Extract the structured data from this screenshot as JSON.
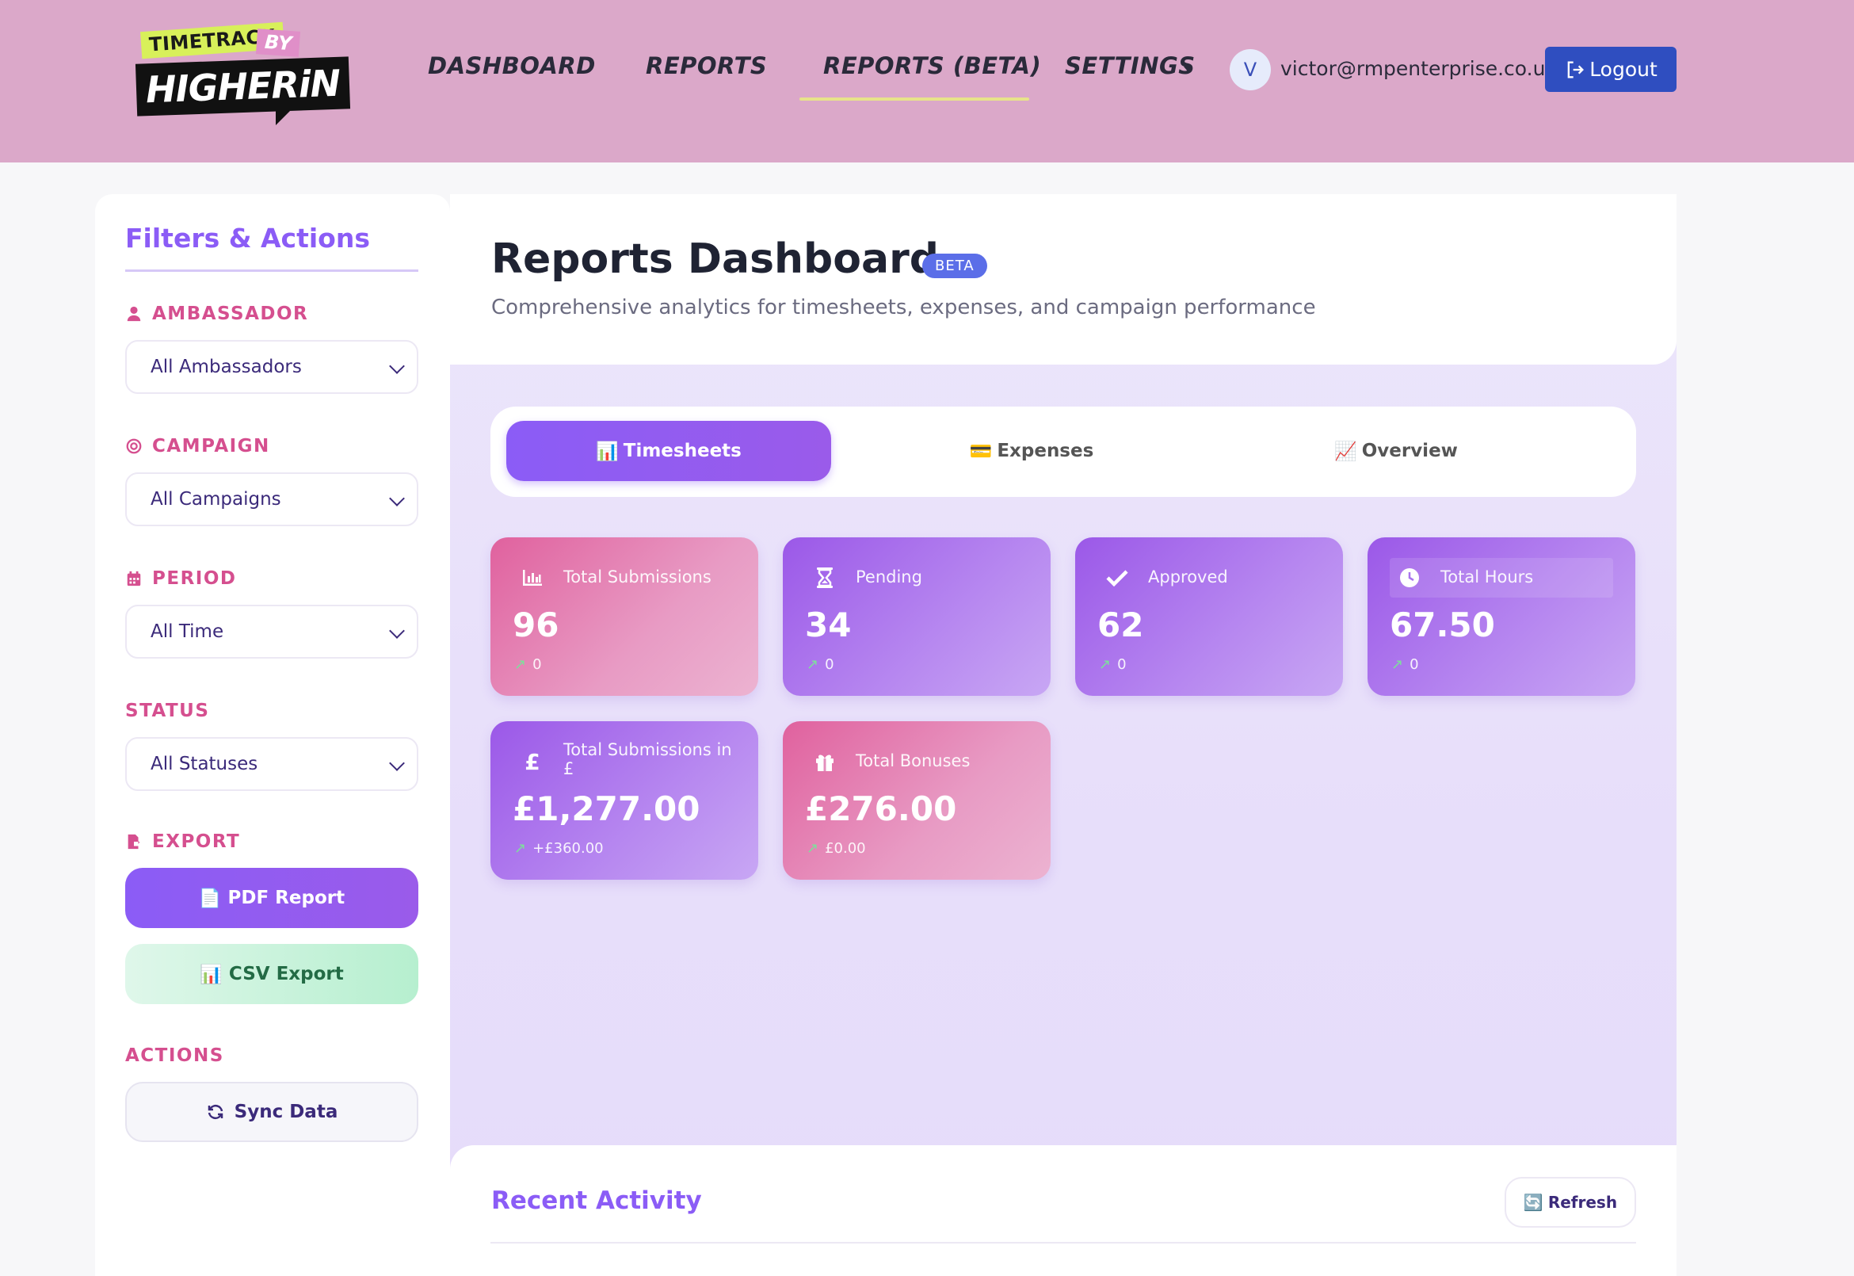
{
  "brand": {
    "logo_line1": "TIMETRACK",
    "logo_by": "BY",
    "logo_line2": "HIGHERiN"
  },
  "nav": {
    "items": [
      {
        "label": "DASHBOARD"
      },
      {
        "label": "REPORTS"
      },
      {
        "label": "REPORTS (BETA)",
        "active": true
      },
      {
        "label": "SETTINGS"
      }
    ],
    "user_initial": "V",
    "user_email": "victor@rmpenterprise.co.uk",
    "logout_label": "Logout"
  },
  "sidebar": {
    "title": "Filters & Actions",
    "ambassador": {
      "label": "AMBASSADOR",
      "value": "All Ambassadors"
    },
    "campaign": {
      "label": "CAMPAIGN",
      "value": "All Campaigns"
    },
    "period": {
      "label": "PERIOD",
      "value": "All Time"
    },
    "status": {
      "label": "STATUS",
      "value": "All Statuses"
    },
    "export": {
      "label": "EXPORT",
      "pdf_label": "PDF Report",
      "csv_label": "CSV Export"
    },
    "actions": {
      "label": "ACTIONS",
      "sync_label": "Sync Data"
    }
  },
  "hero": {
    "title": "Reports Dashboard",
    "badge": "BETA",
    "subtitle": "Comprehensive analytics for timesheets, expenses, and campaign performance"
  },
  "tabs": [
    {
      "label": "Timesheets",
      "active": true
    },
    {
      "label": "Expenses"
    },
    {
      "label": "Overview"
    }
  ],
  "stats": [
    {
      "label": "Total Submissions",
      "value": "96",
      "trend": "0",
      "icon": "bar-chart-icon"
    },
    {
      "label": "Pending",
      "value": "34",
      "trend": "0",
      "icon": "hourglass-icon"
    },
    {
      "label": "Approved",
      "value": "62",
      "trend": "0",
      "icon": "check-icon"
    },
    {
      "label": "Total Hours",
      "value": "67.50",
      "trend": "0",
      "icon": "clock-icon"
    },
    {
      "label": "Total Submissions in £",
      "value": "£1,277.00",
      "trend": "+£360.00",
      "icon": "pound-icon"
    },
    {
      "label": "Total Bonuses",
      "value": "£276.00",
      "trend": "£0.00",
      "icon": "gift-icon"
    }
  ],
  "recent": {
    "title": "Recent Activity",
    "refresh_label": "Refresh"
  },
  "colors": {
    "accent": "#8b5cf6",
    "header_bg": "#dba8c9",
    "logout_bg": "#2f4ec0",
    "section_label": "#d54f8f"
  }
}
